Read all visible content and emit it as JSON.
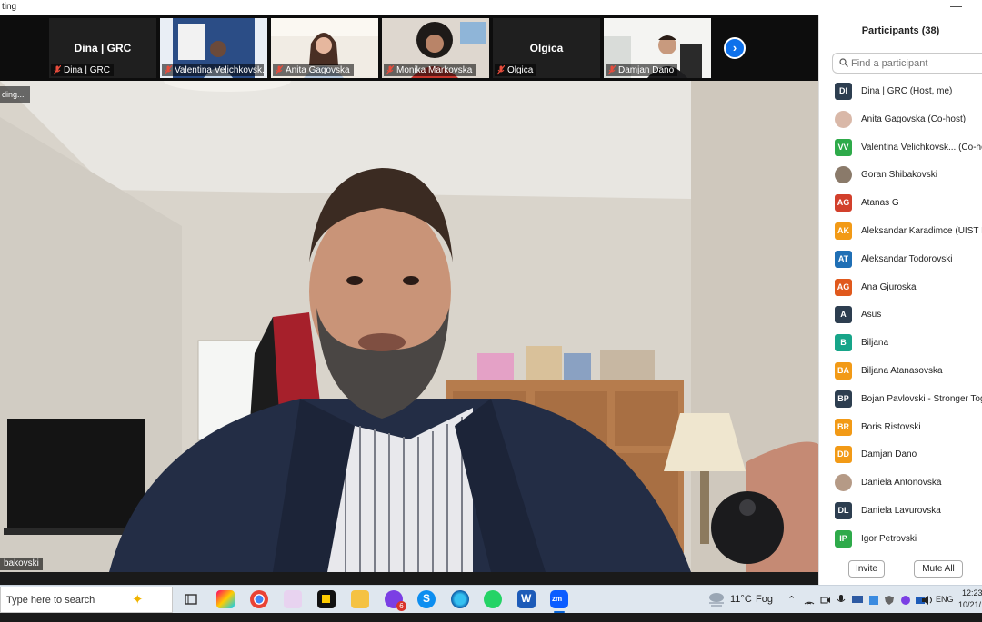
{
  "window": {
    "title": "ting"
  },
  "gallery": {
    "tiles": [
      {
        "big_name": "Dina | GRC",
        "label": "Dina | GRC",
        "video": false
      },
      {
        "big_name": "",
        "label": "Valentina Velichkovsk...",
        "video": true
      },
      {
        "big_name": "",
        "label": "Anita Gagovska",
        "video": true
      },
      {
        "big_name": "",
        "label": "Monika Markovska",
        "video": true
      },
      {
        "big_name": "Olgica",
        "label": "Olgica",
        "video": false
      },
      {
        "big_name": "",
        "label": "Damjan Dano",
        "video": true
      }
    ],
    "next_icon": "chevron-right-icon"
  },
  "main_video": {
    "recording_badge": "ding...",
    "speaker_label": "bakovski"
  },
  "participants": {
    "title": "Participants (38)",
    "search_placeholder": "Find a participant",
    "list": [
      {
        "initials": "DI",
        "name": "Dina | GRC (Host, me)",
        "color": "#2d3e50",
        "photo": false
      },
      {
        "initials": "",
        "name": "Anita Gagovska (Co-host)",
        "color": "#d9b8a8",
        "photo": true
      },
      {
        "initials": "VV",
        "name": "Valentina Velichkovsk...  (Co-host)",
        "color": "#2eaa4a",
        "photo": false
      },
      {
        "initials": "",
        "name": "Goran Shibakovski",
        "color": "#8a7a6a",
        "photo": true
      },
      {
        "initials": "AG",
        "name": "Atanas G",
        "color": "#d2402c",
        "photo": false
      },
      {
        "initials": "AK",
        "name": "Aleksandar Karadimce (UIST Pa",
        "color": "#f29a16",
        "photo": false
      },
      {
        "initials": "AT",
        "name": "Aleksandar Todorovski",
        "color": "#1f6fb5",
        "photo": false
      },
      {
        "initials": "AG",
        "name": "Ana Gjuroska",
        "color": "#e0591d",
        "photo": false
      },
      {
        "initials": "A",
        "name": "Asus",
        "color": "#2d3e50",
        "photo": false
      },
      {
        "initials": "B",
        "name": "Biljana",
        "color": "#17a589",
        "photo": false
      },
      {
        "initials": "BA",
        "name": "Biljana Atanasovska",
        "color": "#f29a16",
        "photo": false
      },
      {
        "initials": "BP",
        "name": "Bojan Pavlovski - Stronger Tog",
        "color": "#2d3e50",
        "photo": false
      },
      {
        "initials": "BR",
        "name": "Boris Ristovski",
        "color": "#f29a16",
        "photo": false
      },
      {
        "initials": "DD",
        "name": "Damjan Dano",
        "color": "#f29a16",
        "photo": false
      },
      {
        "initials": "",
        "name": "Daniela Antonovska",
        "color": "#b59a86",
        "photo": true
      },
      {
        "initials": "DL",
        "name": "Daniela Lavurovska",
        "color": "#2d3e50",
        "photo": false
      },
      {
        "initials": "IP",
        "name": "Igor Petrovski",
        "color": "#2eaa4a",
        "photo": false
      }
    ],
    "invite_label": "Invite",
    "mute_all_label": "Mute All"
  },
  "taskbar": {
    "search_text": "Type here to search",
    "weather_temp": "11°C",
    "weather_condition": "Fog",
    "language": "ENG",
    "time": "12:23",
    "date": "10/21/",
    "badge_count": "6"
  }
}
